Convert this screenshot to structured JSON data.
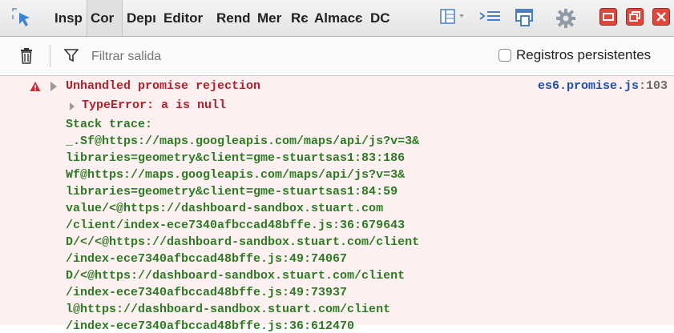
{
  "toolbar": {
    "tabs": [
      {
        "label": "Insp",
        "active": false
      },
      {
        "label": "Cor",
        "active": true
      },
      {
        "label": "Depı",
        "active": false
      },
      {
        "label": "Editor",
        "active": false
      },
      {
        "label": "Rend",
        "active": false
      },
      {
        "label": "Mer",
        "active": false
      },
      {
        "label": "Rє",
        "active": false
      },
      {
        "label": "Almacє",
        "active": false
      },
      {
        "label": "DC",
        "active": false
      }
    ],
    "icons": [
      "element-picker-icon",
      "split-console-icon",
      "toolbox-options-icon",
      "responsive-mode-icon",
      "settings-gear-icon",
      "minimize-window-icon",
      "restore-window-icon",
      "close-window-icon"
    ]
  },
  "filterbar": {
    "filter_placeholder": "Filtrar salida",
    "persist_label": "Registros persistentes",
    "persist_checked": false
  },
  "console": {
    "message": "Unhandled promise rejection",
    "source": "es6.promise.js",
    "source_line": ":103",
    "error": "TypeError: a is null",
    "stack_label": "Stack trace:",
    "stack": [
      "_.Sf@https://maps.googleapis.com/maps/api/js?v=3&",
      "libraries=geometry&client=gme-stuartsas1:83:186",
      "Wf@https://maps.googleapis.com/maps/api/js?v=3&",
      "libraries=geometry&client=gme-stuartsas1:84:59",
      "value/<@https://dashboard-sandbox.stuart.com",
      "/client/index-ece7340afbccad48bffe.js:36:679643",
      "D/</<@https://dashboard-sandbox.stuart.com/client",
      "/index-ece7340afbccad48bffe.js:49:74067",
      "D/<@https://dashboard-sandbox.stuart.com/client",
      "/index-ece7340afbccad48bffe.js:49:73937",
      "l@https://dashboard-sandbox.stuart.com/client",
      "/index-ece7340afbccad48bffe.js:36:612470"
    ]
  },
  "colors": {
    "error": "#b3202a",
    "trace": "#2d7a24",
    "link": "#1c4fa8",
    "window_red": "#e0463a"
  }
}
